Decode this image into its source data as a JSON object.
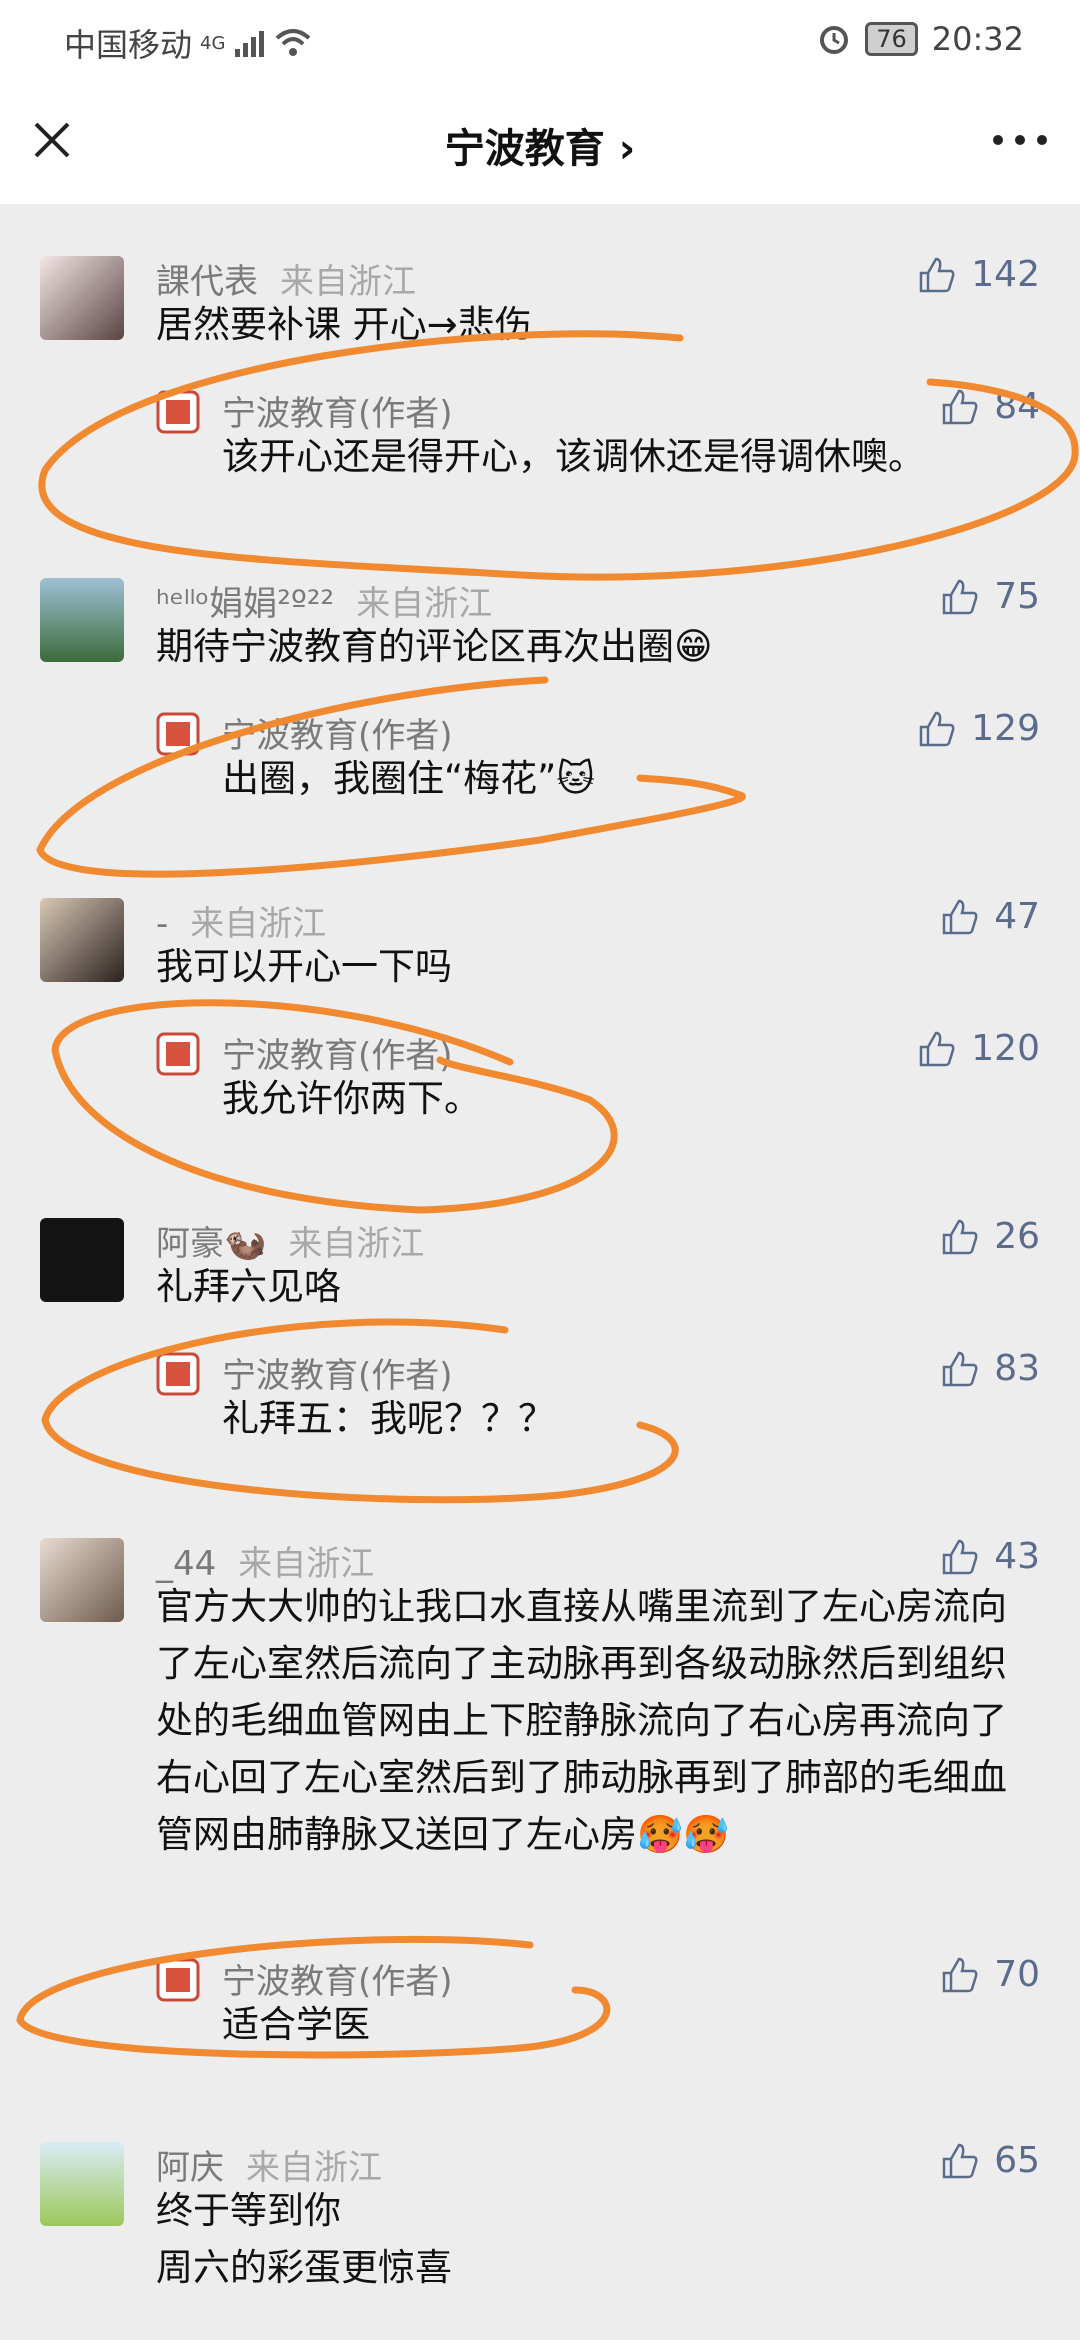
{
  "status": {
    "carrier": "中国移动",
    "net": "4G",
    "battery": "76",
    "time": "20:32"
  },
  "nav": {
    "title": "宁波教育 ›"
  },
  "comments": [
    {
      "user": "課代表",
      "loc": "来自浙江",
      "likes": "142",
      "text": "居然要补课 开心→悲伤",
      "reply": {
        "user": "宁波教育(作者)",
        "likes": "84",
        "text": "该开心还是得开心，该调休还是得调休噢。"
      }
    },
    {
      "user": "ʰᵉˡˡᵒ娟娟²º²²",
      "loc": "来自浙江",
      "likes": "75",
      "text": "期待宁波教育的评论区再次出圈😁",
      "reply": {
        "user": "宁波教育(作者)",
        "likes": "129",
        "text": "出圈，我圈住“梅花”🐱"
      }
    },
    {
      "user": "-",
      "loc": "来自浙江",
      "likes": "47",
      "text": "我可以开心一下吗",
      "reply": {
        "user": "宁波教育(作者)",
        "likes": "120",
        "text": "我允许你两下。"
      }
    },
    {
      "user": "阿豪🦦",
      "loc": "来自浙江",
      "likes": "26",
      "text": "礼拜六见咯",
      "reply": {
        "user": "宁波教育(作者)",
        "likes": "83",
        "text": "礼拜五：我呢？？？"
      }
    },
    {
      "user": "_44",
      "loc": "来自浙江",
      "likes": "43",
      "text": "官方大大帅的让我口水直接从嘴里流到了左心房流向了左心室然后流向了主动脉再到各级动脉然后到组织处的毛细血管网由上下腔静脉流向了右心房再流向了右心回了左心室然后到了肺动脉再到了肺部的毛细血管网由肺静脉又送回了左心房🥵🥵",
      "reply": {
        "user": "宁波教育(作者)",
        "likes": "70",
        "text": "适合学医"
      }
    },
    {
      "user": "阿庆",
      "loc": "来自浙江",
      "likes": "65",
      "text": "终于等到你\n 周六的彩蛋更惊喜"
    }
  ]
}
